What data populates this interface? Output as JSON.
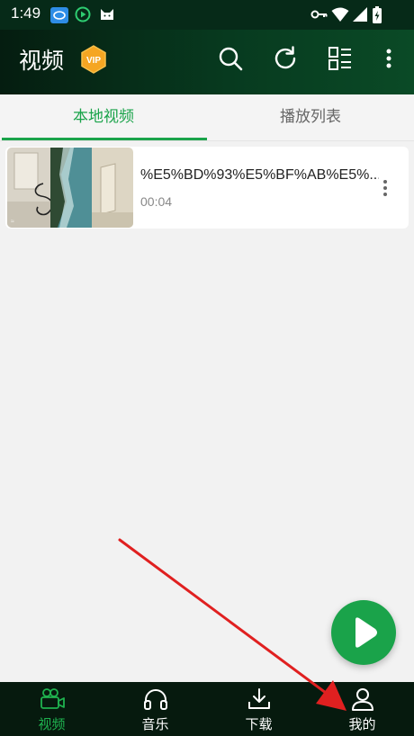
{
  "status_bar": {
    "time": "1:49",
    "notification_icons": [
      "baidu-app-icon",
      "play-circle-icon",
      "cat-icon"
    ],
    "system_icons": [
      "key-icon",
      "wifi-icon",
      "signal-icon",
      "battery-charging-icon"
    ]
  },
  "app_bar": {
    "title": "视频",
    "badge": "VIP",
    "actions": [
      "search-icon",
      "refresh-icon",
      "view-list-icon",
      "more-vert-icon"
    ]
  },
  "tabs": [
    {
      "label": "本地视频",
      "active": true
    },
    {
      "label": "播放列表",
      "active": false
    }
  ],
  "videos": [
    {
      "name": "%E5%BD%93%E5%BF%AB%E5%...",
      "duration": "00:04"
    }
  ],
  "bottom_nav": [
    {
      "label": "视频",
      "icon": "video-camera-icon",
      "active": true
    },
    {
      "label": "音乐",
      "icon": "headphones-icon",
      "active": false
    },
    {
      "label": "下载",
      "icon": "download-icon",
      "active": false
    },
    {
      "label": "我的",
      "icon": "person-icon",
      "active": false
    }
  ],
  "colors": {
    "accent": "#1aa34a",
    "header_bg": "#062a18",
    "nav_bg": "#061a0e",
    "annotation_arrow": "#e02020"
  }
}
